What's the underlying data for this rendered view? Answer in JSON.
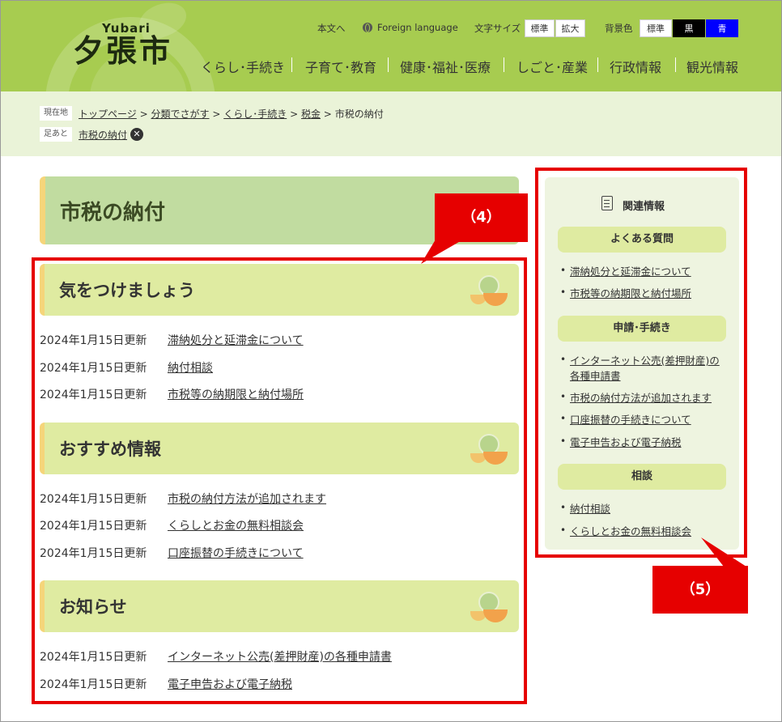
{
  "header": {
    "logo_en": "Yubari",
    "logo_jp": "夕張市",
    "skip": "本文へ",
    "foreign": "Foreign language",
    "font_size_label": "文字サイズ",
    "font_std": "標準",
    "font_large": "拡大",
    "bg_label": "背景色",
    "bg_std": "標準",
    "bg_black": "黒",
    "bg_blue": "青",
    "nav": [
      "くらし･手続き",
      "子育て･教育",
      "健康･福祉･医療",
      "しごと･産業",
      "行政情報",
      "観光情報"
    ]
  },
  "breadcrumb": {
    "current_label": "現在地",
    "items": [
      "トップページ",
      "分類でさがす",
      "くらし･手続き",
      "税金"
    ],
    "sep": ">",
    "current": "市税の納付",
    "footprint_label": "足あと",
    "footprint_item": "市税の納付",
    "close_glyph": "✕"
  },
  "main": {
    "title": "市税の納付",
    "sections": [
      {
        "heading": "気をつけましょう",
        "items": [
          {
            "date": "2024年1月15日更新",
            "title": "滞納処分と延滞金について"
          },
          {
            "date": "2024年1月15日更新",
            "title": "納付相談"
          },
          {
            "date": "2024年1月15日更新",
            "title": "市税等の納期限と納付場所"
          }
        ]
      },
      {
        "heading": "おすすめ情報",
        "items": [
          {
            "date": "2024年1月15日更新",
            "title": "市税の納付方法が追加されます"
          },
          {
            "date": "2024年1月15日更新",
            "title": "くらしとお金の無料相談会"
          },
          {
            "date": "2024年1月15日更新",
            "title": "口座振替の手続きについて"
          }
        ]
      },
      {
        "heading": "お知らせ",
        "items": [
          {
            "date": "2024年1月15日更新",
            "title": "インターネット公売(差押財産)の各種申請書"
          },
          {
            "date": "2024年1月15日更新",
            "title": "電子申告および電子納税"
          }
        ]
      }
    ]
  },
  "sidebar": {
    "title": "関連情報",
    "categories": [
      {
        "name": "よくある質問",
        "links": [
          "滞納処分と延滞金について",
          "市税等の納期限と納付場所"
        ]
      },
      {
        "name": "申請･手続き",
        "links": [
          "インターネット公売(差押財産)の",
          "各種申請書",
          "市税の納付方法が追加されます",
          "口座振替の手続きについて",
          "電子申告および電子納税"
        ]
      },
      {
        "name": "相談",
        "links": [
          "納付相談",
          "くらしとお金の無料相談会"
        ]
      }
    ]
  },
  "annotations": {
    "label4": "（4）",
    "label5": "（5）"
  },
  "colors": {
    "header": "#a7cc50",
    "crumb_bg": "#eaf3d8",
    "section": "#dfeba1",
    "accent": "#f5d57a",
    "annotation": "#e60000"
  }
}
